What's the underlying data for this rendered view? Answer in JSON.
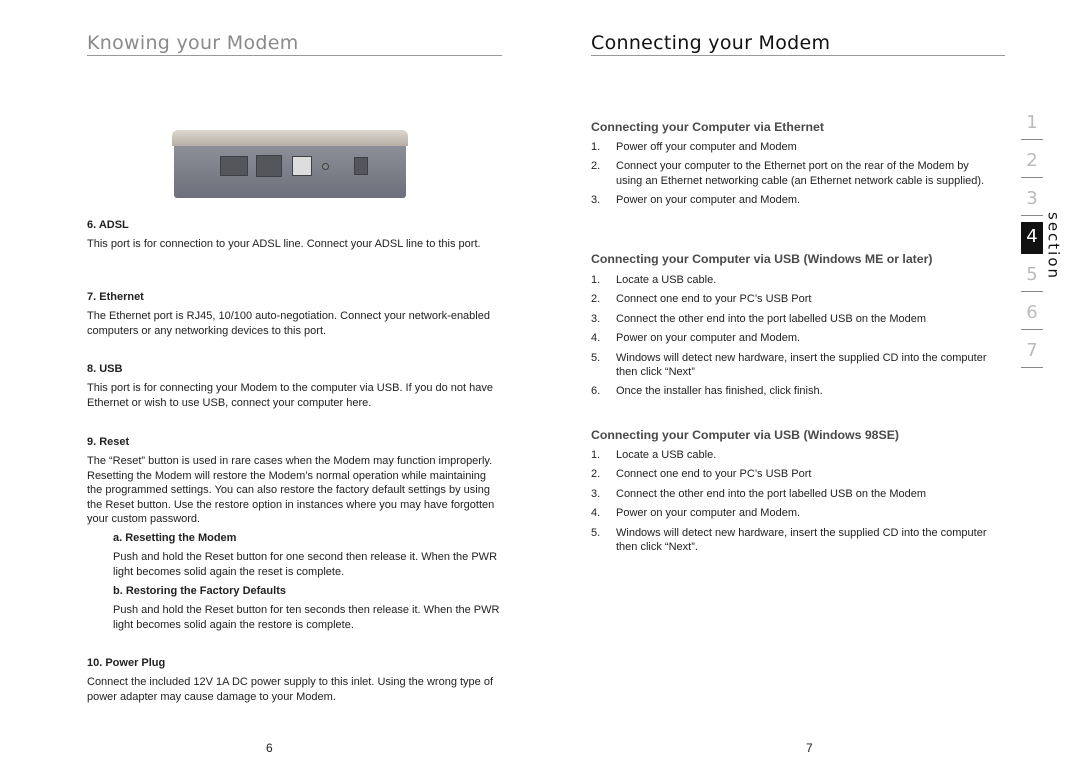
{
  "left": {
    "title": "Knowing your Modem",
    "sections": [
      {
        "heading": "6.  ADSL",
        "text": "This port is for connection to your ADSL line. Connect your ADSL line to this port."
      },
      {
        "heading": "7.  Ethernet",
        "text": "The Ethernet port is RJ45, 10/100 auto-negotiation. Connect your network-enabled computers or any networking devices to this port."
      },
      {
        "heading": "8.  USB",
        "text": "This port is for connecting your Modem to the computer via USB.  If you do not have Ethernet or wish to use USB, connect your computer here."
      },
      {
        "heading": "9.  Reset",
        "text": "The “Reset” button is used in rare cases when the Modem may function improperly. Resetting the Modem will restore the Modem’s normal operation while maintaining the programmed settings. You can also restore the factory default settings by using the Reset button. Use the restore option in instances where you may have forgotten your custom password."
      },
      {
        "heading": "a.  Resetting the Modem",
        "text": "Push and hold the Reset button for one second then release it. When the PWR light becomes solid again the reset is complete."
      },
      {
        "heading": "b.  Restoring the Factory Defaults",
        "text": "Push and hold the Reset button for ten seconds then release it. When the PWR light becomes solid again the restore is complete."
      },
      {
        "heading": "10.  Power Plug",
        "text": "Connect the included 12V 1A DC power supply to this inlet.  Using the wrong type of power adapter may cause damage to your Modem."
      }
    ],
    "page_number": "6"
  },
  "right": {
    "title": "Connecting your Modem",
    "groups": [
      {
        "heading": "Connecting your Computer via Ethernet",
        "items": [
          "Power off your computer and Modem",
          "Connect your computer to the Ethernet port on the rear of the Modem by using an Ethernet networking cable (an Ethernet network cable is supplied).",
          "Power on your computer and Modem."
        ]
      },
      {
        "heading": "Connecting your Computer via USB (Windows ME or later)",
        "items": [
          "Locate a USB cable.",
          "Connect one end to your PC’s USB Port",
          "Connect the other end into the port labelled USB on the Modem",
          "Power on your computer and Modem.",
          "Windows will detect new hardware, insert the supplied CD into the  computer then click “Next”",
          "Once the installer has finished, click finish."
        ]
      },
      {
        "heading": "Connecting your Computer via USB (Windows 98SE)",
        "items": [
          "Locate a USB cable.",
          "Connect one end to your PC’s USB Port",
          "Connect the other end into the port labelled USB on the Modem",
          "Power on your computer and Modem.",
          "Windows will detect new hardware, insert the supplied CD into the computer then click “Next”."
        ]
      }
    ],
    "page_number": "7"
  },
  "section_tabs": {
    "label": "section",
    "numbers": [
      "1",
      "2",
      "3",
      "4",
      "5",
      "6",
      "7"
    ],
    "active": "4"
  }
}
